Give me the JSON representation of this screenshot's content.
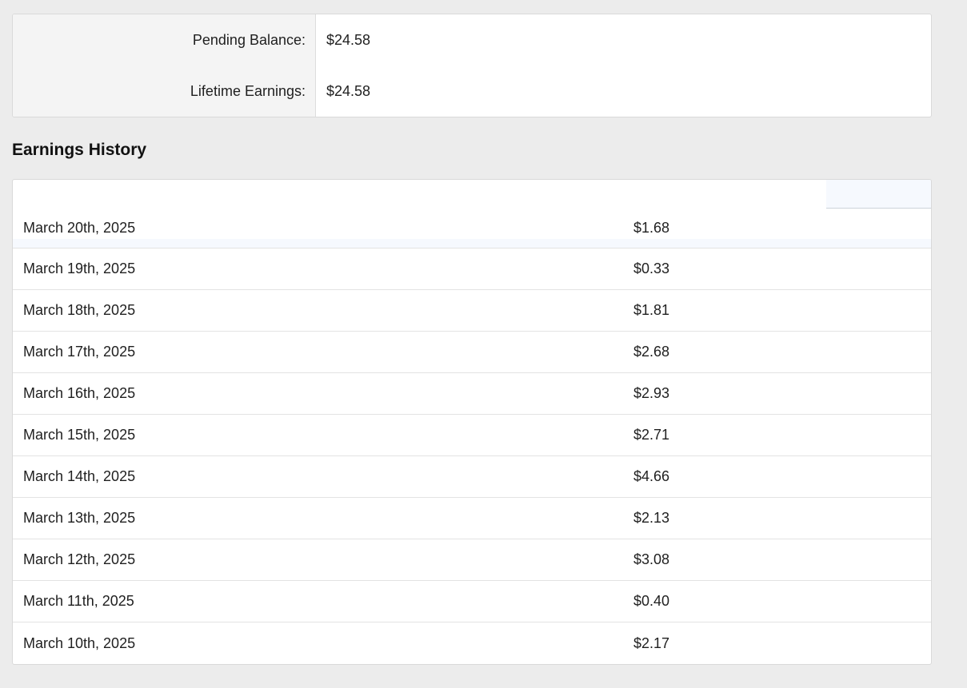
{
  "summary": {
    "pending_label": "Pending Balance:",
    "pending_value": "$24.58",
    "lifetime_label": "Lifetime Earnings:",
    "lifetime_value": "$24.58"
  },
  "history": {
    "title": "Earnings History",
    "rows": [
      {
        "date": "March 20th, 2025",
        "amount": "$1.68"
      },
      {
        "date": "March 19th, 2025",
        "amount": "$0.33"
      },
      {
        "date": "March 18th, 2025",
        "amount": "$1.81"
      },
      {
        "date": "March 17th, 2025",
        "amount": "$2.68"
      },
      {
        "date": "March 16th, 2025",
        "amount": "$2.93"
      },
      {
        "date": "March 15th, 2025",
        "amount": "$2.71"
      },
      {
        "date": "March 14th, 2025",
        "amount": "$4.66"
      },
      {
        "date": "March 13th, 2025",
        "amount": "$2.13"
      },
      {
        "date": "March 12th, 2025",
        "amount": "$3.08"
      },
      {
        "date": "March 11th, 2025",
        "amount": "$0.40"
      },
      {
        "date": "March 10th, 2025",
        "amount": "$2.17"
      }
    ]
  }
}
